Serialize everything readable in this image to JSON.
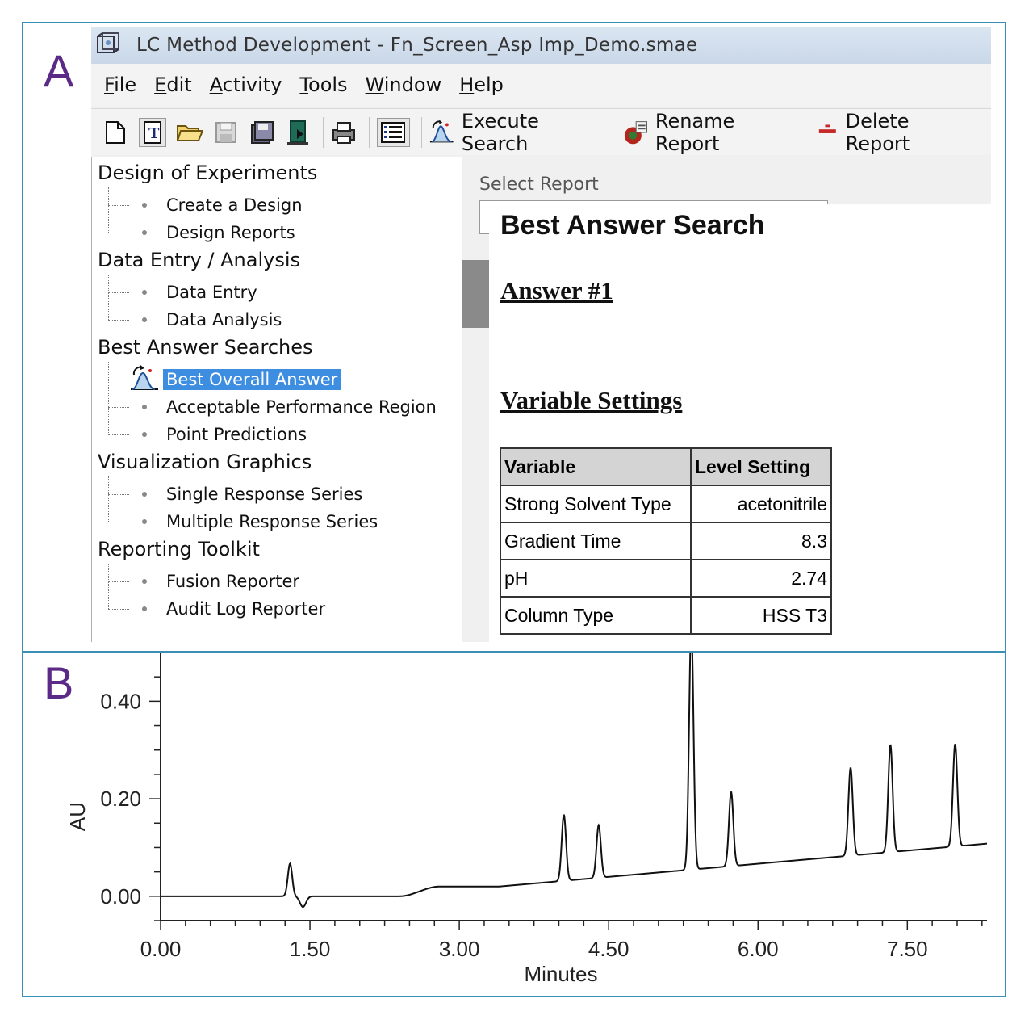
{
  "panels": {
    "a_label": "A",
    "b_label": "B"
  },
  "window": {
    "title": "LC Method Development - Fn_Screen_Asp Imp_Demo.smae",
    "menu": [
      {
        "mnemonic": "F",
        "rest": "ile"
      },
      {
        "mnemonic": "E",
        "rest": "dit"
      },
      {
        "mnemonic": "A",
        "rest": "ctivity"
      },
      {
        "mnemonic": "T",
        "rest": "ools"
      },
      {
        "mnemonic": "W",
        "rest": "indow"
      },
      {
        "mnemonic": "H",
        "rest": "elp"
      }
    ],
    "toolbar": {
      "execute_search": "Execute Search",
      "rename_report": "Rename Report",
      "delete_report": "Delete Report"
    }
  },
  "tree": {
    "groups": [
      {
        "label": "Design of Experiments",
        "items": [
          "Create a Design",
          "Design Reports"
        ]
      },
      {
        "label": "Data Entry / Analysis",
        "items": [
          "Data Entry",
          "Data Analysis"
        ]
      },
      {
        "label": "Best Answer Searches",
        "items": [
          "Best Overall Answer",
          "Acceptable Performance Region",
          "Point Predictions"
        ]
      },
      {
        "label": "Visualization Graphics",
        "items": [
          "Single Response Series",
          "Multiple Response Series"
        ]
      },
      {
        "label": "Reporting Toolkit",
        "items": [
          "Fusion Reporter",
          "Audit Log Reporter"
        ]
      }
    ],
    "selected": "Best Overall Answer"
  },
  "report": {
    "select_label": "Select Report",
    "title": "Best Answer Search",
    "answer_heading": "Answer #1",
    "variables_heading": "Variable Settings",
    "table": {
      "headers": [
        "Variable",
        "Level Setting"
      ],
      "rows": [
        [
          "Strong Solvent Type",
          "acetonitrile"
        ],
        [
          "Gradient Time",
          "8.3"
        ],
        [
          "pH",
          "2.74"
        ],
        [
          "Column Type",
          "HSS T3"
        ]
      ]
    }
  },
  "chart_data": {
    "type": "line",
    "xlabel": "Minutes",
    "ylabel": "AU",
    "xlim": [
      0,
      8.3
    ],
    "ylim": [
      -0.05,
      0.5
    ],
    "x_ticks": [
      "0.00",
      "1.50",
      "3.00",
      "4.50",
      "6.00",
      "7.50"
    ],
    "y_ticks": [
      "0.00",
      "0.20",
      "0.40"
    ],
    "baseline": [
      [
        0,
        0
      ],
      [
        1.2,
        0
      ],
      [
        2.4,
        0.0
      ],
      [
        2.8,
        0.02
      ],
      [
        3.4,
        0.02
      ],
      [
        8.3,
        0.108
      ]
    ],
    "peaks": [
      {
        "t": 1.3,
        "height": 0.067
      },
      {
        "t": 4.05,
        "height": 0.135
      },
      {
        "t": 4.4,
        "height": 0.108
      },
      {
        "t": 5.33,
        "height": 0.5
      },
      {
        "t": 5.73,
        "height": 0.152
      },
      {
        "t": 6.93,
        "height": 0.18
      },
      {
        "t": 7.33,
        "height": 0.22
      },
      {
        "t": 7.98,
        "height": 0.21
      }
    ],
    "dip": {
      "t": 1.43,
      "depth": -0.022
    },
    "line_color": "#111111"
  }
}
